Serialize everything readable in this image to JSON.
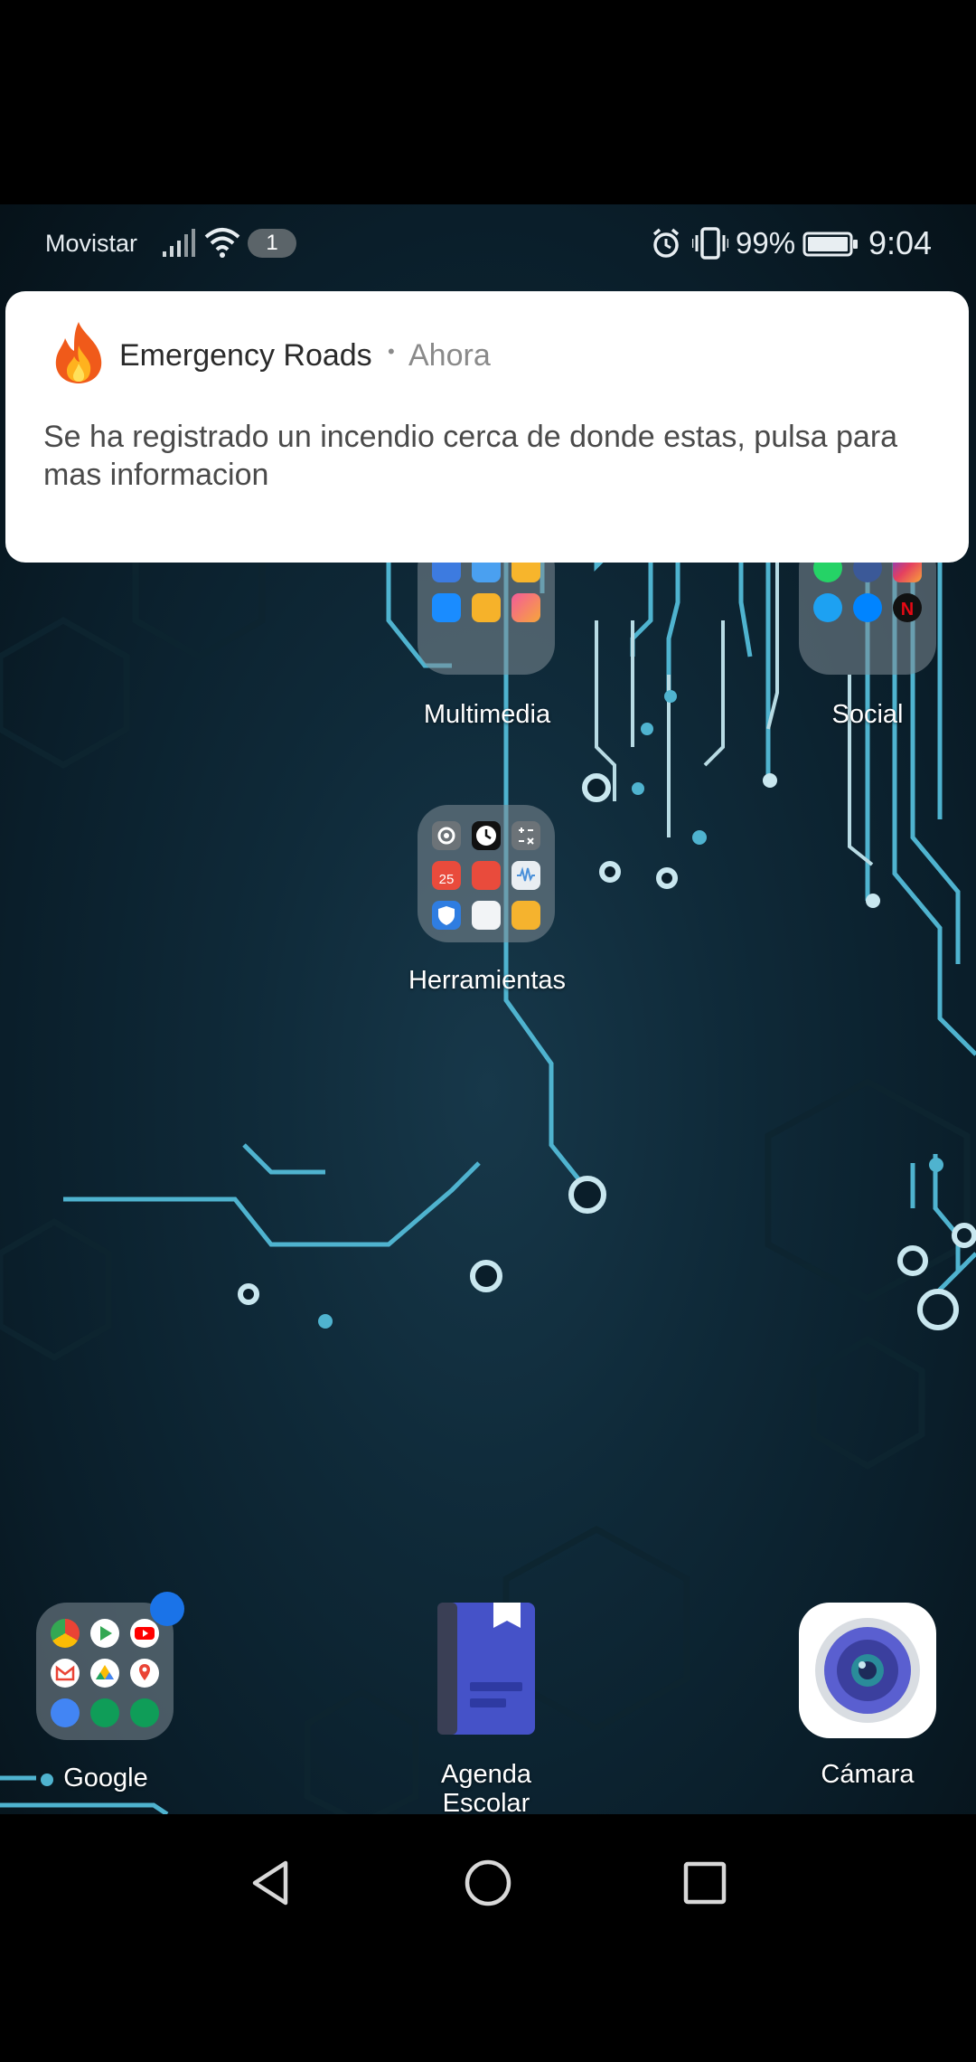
{
  "status_bar": {
    "carrier": "Movistar",
    "sim_badge": "1",
    "battery_percent": "99%",
    "time": "9:04",
    "icons": [
      "signal-icon",
      "wifi-icon",
      "alarm-icon",
      "vibrate-icon",
      "battery-icon"
    ]
  },
  "notification": {
    "app_name": "Emergency Roads",
    "separator": "•",
    "time": "Ahora",
    "message": "Se ha registrado un incendio cerca de donde estas, pulsa para mas informacion",
    "icon": "fire-icon"
  },
  "home": {
    "folders": [
      {
        "label": "Multimedia"
      },
      {
        "label": "Social"
      },
      {
        "label": "Herramientas"
      }
    ],
    "dock": [
      {
        "label": "Google"
      },
      {
        "label": "Agenda Escolar"
      },
      {
        "label": "Cámara"
      }
    ]
  },
  "navigation": {
    "buttons": [
      "back-icon",
      "home-icon",
      "recents-icon"
    ]
  },
  "colors": {
    "notification_bg": "#ffffff",
    "accent_blue": "#1a73e8",
    "circuit": "#3aa6c8"
  }
}
